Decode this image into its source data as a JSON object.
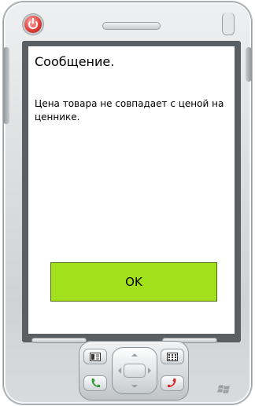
{
  "dialog": {
    "title": "Сообщение.",
    "message": "Цена товара не совпадает с ценой на ценнике.",
    "ok_label": "OK"
  },
  "colors": {
    "ok_button": "#a2e01c",
    "power_button": "#e0403c",
    "call_green": "#2e9b2e",
    "end_red": "#d8282a"
  },
  "icons": [
    "power-icon",
    "calendar-icon",
    "contacts-icon",
    "call-icon",
    "end-call-icon",
    "windows-logo-icon"
  ]
}
